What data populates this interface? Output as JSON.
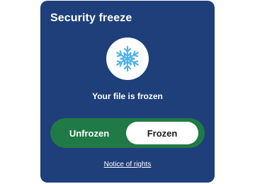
{
  "card": {
    "title": "Security freeze",
    "icon": "snowflake-icon",
    "status": "Your file is frozen"
  },
  "toggle": {
    "options": [
      "Unfrozen",
      "Frozen"
    ],
    "selected": "Frozen"
  },
  "link": {
    "notice": "Notice of rights"
  },
  "colors": {
    "card_background": "#1e3f7a",
    "toggle_background": "#1f7a45",
    "icon_color": "#4fb3e8"
  }
}
